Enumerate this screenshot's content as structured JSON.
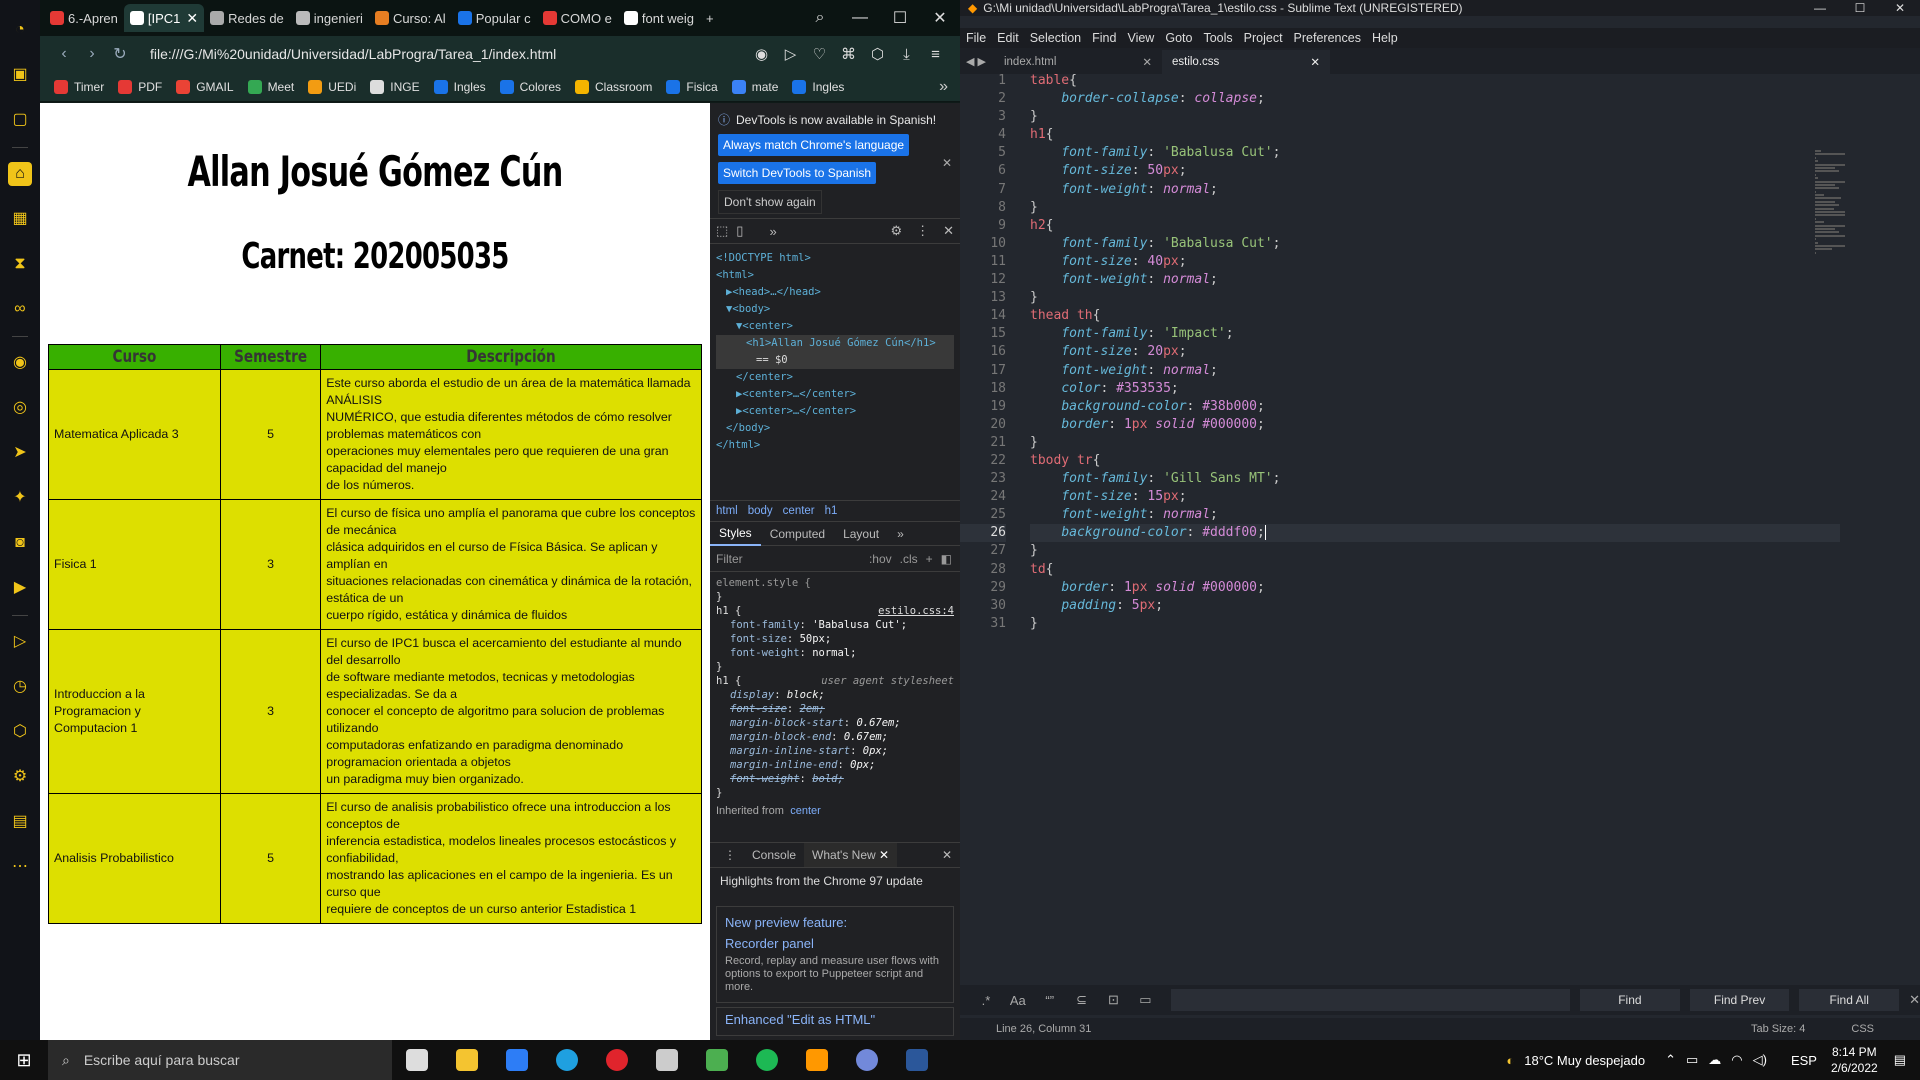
{
  "opera_sidebar": {
    "icons": [
      "speed-dial-icon",
      "bag-icon",
      "twitch-icon",
      "home-icon",
      "gamepad-icon",
      "hourglass-icon",
      "bike-icon",
      "messenger-icon",
      "whatsapp-icon",
      "telegram-icon",
      "twitter-icon",
      "discord-icon",
      "play-icon",
      "send-icon",
      "clock-icon",
      "cube-icon",
      "settings-icon",
      "app-icon",
      "more-icon"
    ]
  },
  "browser": {
    "tabs": [
      {
        "label": "6.-Apren",
        "color": "#e53935"
      },
      {
        "label": "[IPC1",
        "color": "#ffffff",
        "active": true
      },
      {
        "label": "Redes de",
        "color": "#aaaaaa"
      },
      {
        "label": "ingenieri",
        "color": "#bbbbbb"
      },
      {
        "label": "Curso: Al",
        "color": "#e67e22"
      },
      {
        "label": "Popular c",
        "color": "#1a73e8"
      },
      {
        "label": "COMO e",
        "color": "#e53935"
      },
      {
        "label": "font weig",
        "color": "#ffffff"
      }
    ],
    "new_tab": "+",
    "url": "file:///G:/Mi%20unidad/Universidad/LabProgra/Tarea_1/index.html",
    "bookmarks": [
      {
        "label": "Timer",
        "color": "#e53935"
      },
      {
        "label": "PDF",
        "color": "#e53935"
      },
      {
        "label": "GMAIL",
        "color": "#ea4335"
      },
      {
        "label": "Meet",
        "color": "#34a853"
      },
      {
        "label": "UEDi",
        "color": "#f39c12"
      },
      {
        "label": "INGE",
        "color": "#dddddd"
      },
      {
        "label": "Ingles",
        "color": "#1a73e8"
      },
      {
        "label": "Colores",
        "color": "#1a73e8"
      },
      {
        "label": "Classroom",
        "color": "#f4b400"
      },
      {
        "label": "Fisica",
        "color": "#1a73e8"
      },
      {
        "label": "mate",
        "color": "#3b82f6"
      },
      {
        "label": "Ingles",
        "color": "#1a73e8"
      }
    ]
  },
  "page": {
    "h1": "Allan Josué Gómez Cún",
    "h2": "Carnet: 202005035",
    "headers": [
      "Curso",
      "Semestre",
      "Descripción"
    ],
    "rows": [
      {
        "curso": "Matematica Aplicada 3",
        "semestre": "5",
        "descripcion": "Este curso aborda el estudio de un área de la matemática llamada ANÁLISIS\nNUMÉRICO, que estudia diferentes métodos de cómo resolver problemas matemáticos con\noperaciones muy elementales pero que requieren de una gran capacidad del manejo\nde los números."
      },
      {
        "curso": "Fisica 1",
        "semestre": "3",
        "descripcion": "El curso de física uno amplía el panorama que cubre los conceptos de mecánica\nclásica adquiridos en el curso de Física Básica. Se aplican y amplían en\nsituaciones relacionadas con cinemática y dinámica de la rotación, estática de un\ncuerpo rígido, estática y dinámica de fluidos"
      },
      {
        "curso": "Introduccion a la Programacion y Computacion 1",
        "semestre": "3",
        "descripcion": "El curso de IPC1 busca el acercamiento del estudiante al mundo del desarrollo\nde software mediante metodos, tecnicas y metodologias especializadas. Se da a\nconocer el concepto de algoritmo para solucion de problemas utilizando\ncomputadoras enfatizando en paradigma denominado programacion orientada a objetos\nun paradigma muy bien organizado."
      },
      {
        "curso": "Analisis Probabilistico",
        "semestre": "5",
        "descripcion": "El curso de analisis probabilistico ofrece una introduccion a los conceptos de\ninferencia estadistica, modelos lineales procesos estocásticos y confiabilidad,\nmostrando las aplicaciones en el campo de la ingenieria. Es un curso que\nrequiere de conceptos de un curso anterior Estadistica 1"
      }
    ]
  },
  "devtools": {
    "info": "DevTools is now available in Spanish!",
    "btn_match": "Always match Chrome's language",
    "btn_switch": "Switch DevTools to Spanish",
    "btn_dont": "Don't show again",
    "dom_lines": [
      {
        "t": "<!DOCTYPE html>",
        "indent": 0
      },
      {
        "t": "<html>",
        "indent": 0
      },
      {
        "t": "▶<head>…</head>",
        "indent": 1
      },
      {
        "t": "▼<body>",
        "indent": 1
      },
      {
        "t": "▼<center>",
        "indent": 2
      },
      {
        "t": "<h1>Allan Josué Gómez Cún</h1>",
        "indent": 3,
        "sel": true
      },
      {
        "t": "== $0",
        "indent": 4,
        "sel": true
      },
      {
        "t": "</center>",
        "indent": 2
      },
      {
        "t": "▶<center>…</center>",
        "indent": 2
      },
      {
        "t": "▶<center>…</center>",
        "indent": 2
      },
      {
        "t": "</body>",
        "indent": 1
      },
      {
        "t": "</html>",
        "indent": 0
      }
    ],
    "crumbs": [
      "html",
      "body",
      "center",
      "h1"
    ],
    "style_tabs": [
      "Styles",
      "Computed",
      "Layout",
      "»"
    ],
    "filter_placeholder": "Filter",
    "filter_hov": ":hov",
    "filter_cls": ".cls",
    "styles": {
      "element_style": "element.style {",
      "close": "}",
      "h1_selector": "h1 {",
      "h1_source": "estilo.css:4",
      "h1_props": [
        [
          "font-family",
          "'Babalusa Cut';"
        ],
        [
          "font-size",
          "50px;"
        ],
        [
          "font-weight",
          "normal;"
        ]
      ],
      "ua_selector": "h1 {",
      "ua_source": "user agent stylesheet",
      "ua_props": [
        [
          "display",
          "block;",
          false
        ],
        [
          "font-size",
          "2em;",
          true
        ],
        [
          "margin-block-start",
          "0.67em;",
          false
        ],
        [
          "margin-block-end",
          "0.67em;",
          false
        ],
        [
          "margin-inline-start",
          "0px;",
          false
        ],
        [
          "margin-inline-end",
          "0px;",
          false
        ],
        [
          "font-weight",
          "bold;",
          true
        ]
      ],
      "inherited_prefix": "Inherited from",
      "inherited_from": "center"
    },
    "drawer_tabs": [
      "Console",
      "What's New"
    ],
    "whatsnew_title": "Highlights from the Chrome 97 update",
    "card_title": "New preview feature:",
    "card_subtitle": "Recorder panel",
    "card_text": "Record, replay and measure user flows with options to export to Puppeteer script and more.",
    "card2_title": "Enhanced \"Edit as HTML\""
  },
  "sublime": {
    "title": "G:\\Mi unidad\\Universidad\\LabProgra\\Tarea_1\\estilo.css - Sublime Text (UNREGISTERED)",
    "menu": [
      "File",
      "Edit",
      "Selection",
      "Find",
      "View",
      "Goto",
      "Tools",
      "Project",
      "Preferences",
      "Help"
    ],
    "tabs": [
      {
        "label": "index.html"
      },
      {
        "label": "estilo.css",
        "active": true
      }
    ],
    "current_line": 26,
    "find_btn": "Find",
    "find_prev_btn": "Find Prev",
    "find_all_btn": "Find All",
    "status_pos": "Line 26, Column 31",
    "status_tab": "Tab Size: 4",
    "status_syntax": "CSS"
  },
  "taskbar": {
    "search_placeholder": "Escribe aquí para buscar",
    "weather": "18°C  Muy despejado",
    "lang": "ESP",
    "time": "8:14 PM",
    "date": "2/6/2022",
    "apps": [
      {
        "name": "task-view",
        "color": "#dddddd"
      },
      {
        "name": "file-explorer",
        "color": "#f4c430"
      },
      {
        "name": "store",
        "color": "#2d7df6"
      },
      {
        "name": "edge",
        "color": "#1fa0e0"
      },
      {
        "name": "opera",
        "color": "#e0242c"
      },
      {
        "name": "github",
        "color": "#cccccc"
      },
      {
        "name": "network-app",
        "color": "#4caf50"
      },
      {
        "name": "spotify",
        "color": "#1db954"
      },
      {
        "name": "sublime",
        "color": "#ff9800"
      },
      {
        "name": "discord",
        "color": "#7289da"
      },
      {
        "name": "word",
        "color": "#2b579a"
      }
    ]
  }
}
